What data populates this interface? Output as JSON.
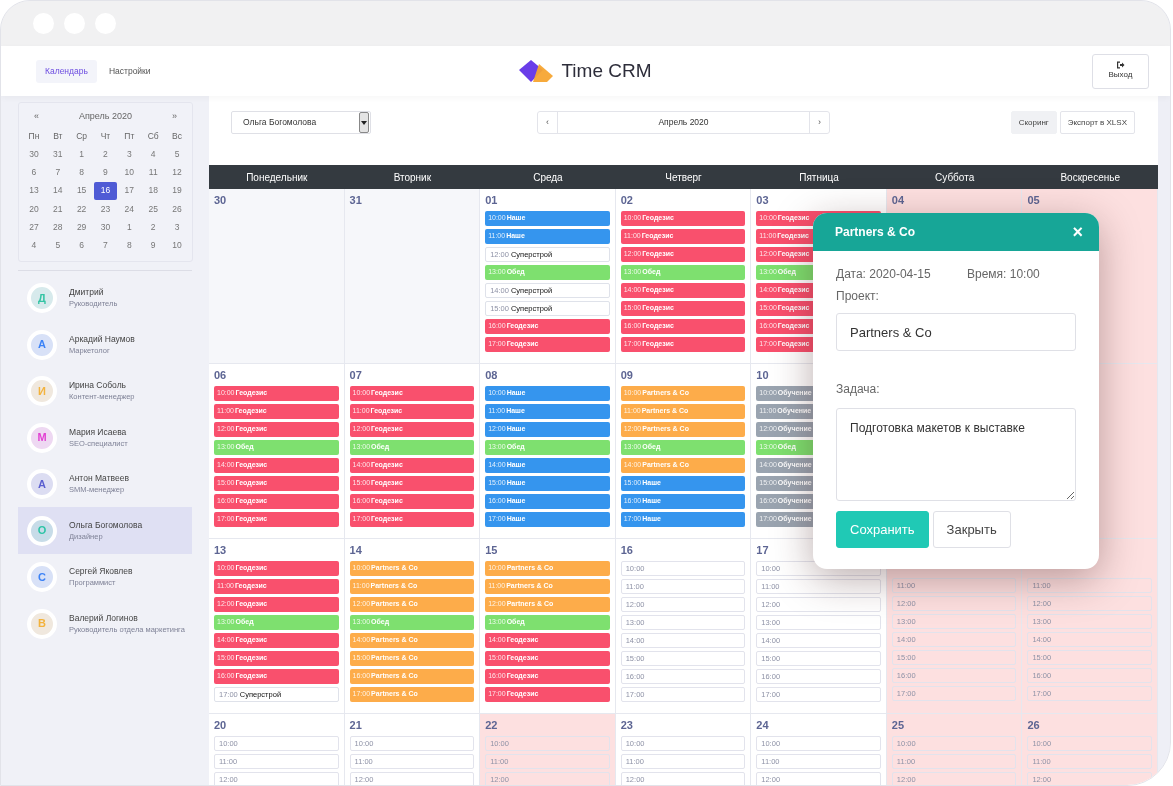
{
  "header": {
    "tabs": [
      {
        "label": "Календарь",
        "selected": true
      },
      {
        "label": "Настройки",
        "selected": false
      }
    ],
    "logo": "Time CRM",
    "logout": "Выход"
  },
  "sidebar": {
    "mini_calendar": {
      "prev": "«",
      "title": "Апрель 2020",
      "next": "»",
      "weekdays": [
        "Пн",
        "Вт",
        "Ср",
        "Чт",
        "Пт",
        "Сб",
        "Вс"
      ],
      "dates": [
        {
          "label": "30",
          "selected": false
        },
        {
          "label": "31",
          "selected": false
        },
        {
          "label": "1",
          "selected": false
        },
        {
          "label": "2",
          "selected": false
        },
        {
          "label": "3",
          "selected": false
        },
        {
          "label": "4",
          "selected": false
        },
        {
          "label": "5",
          "selected": false
        },
        {
          "label": "6",
          "selected": false
        },
        {
          "label": "7",
          "selected": false
        },
        {
          "label": "8",
          "selected": false
        },
        {
          "label": "9",
          "selected": false
        },
        {
          "label": "10",
          "selected": false
        },
        {
          "label": "11",
          "selected": false
        },
        {
          "label": "12",
          "selected": false
        },
        {
          "label": "13",
          "selected": false
        },
        {
          "label": "14",
          "selected": false
        },
        {
          "label": "15",
          "selected": false
        },
        {
          "label": "16",
          "selected": true
        },
        {
          "label": "17",
          "selected": false
        },
        {
          "label": "18",
          "selected": false
        },
        {
          "label": "19",
          "selected": false
        },
        {
          "label": "20",
          "selected": false
        },
        {
          "label": "21",
          "selected": false
        },
        {
          "label": "22",
          "selected": false
        },
        {
          "label": "23",
          "selected": false
        },
        {
          "label": "24",
          "selected": false
        },
        {
          "label": "25",
          "selected": false
        },
        {
          "label": "26",
          "selected": false
        },
        {
          "label": "27",
          "selected": false
        },
        {
          "label": "28",
          "selected": false
        },
        {
          "label": "29",
          "selected": false
        },
        {
          "label": "30",
          "selected": false
        },
        {
          "label": "1",
          "selected": false
        },
        {
          "label": "2",
          "selected": false
        },
        {
          "label": "3",
          "selected": false
        },
        {
          "label": "4",
          "selected": false
        },
        {
          "label": "5",
          "selected": false
        },
        {
          "label": "6",
          "selected": false
        },
        {
          "label": "7",
          "selected": false
        },
        {
          "label": "8",
          "selected": false
        },
        {
          "label": "9",
          "selected": false
        },
        {
          "label": "10",
          "selected": false
        }
      ]
    },
    "people": [
      {
        "initial": "Д",
        "name": "Дмитрий",
        "role": "Руководитель",
        "color": "#35c4a4",
        "selected": false
      },
      {
        "initial": "А",
        "name": "Аркадий Наумов",
        "role": "Маркетолог",
        "color": "#3b82f6",
        "selected": false
      },
      {
        "initial": "И",
        "name": "Ирина Соболь",
        "role": "Контент-менеджер",
        "color": "#f3b23c",
        "selected": false
      },
      {
        "initial": "М",
        "name": "Мария Исаева",
        "role": "SEO-специалист",
        "color": "#e23fd2",
        "selected": false
      },
      {
        "initial": "А",
        "name": "Антон Матвеев",
        "role": "SMM-менеджер",
        "color": "#5b5fd0",
        "selected": false
      },
      {
        "initial": "О",
        "name": "Ольга Богомолова",
        "role": "Дизайнер",
        "color": "#2cc4a6",
        "selected": true
      },
      {
        "initial": "С",
        "name": "Сергей Яковлев",
        "role": "Программист",
        "color": "#3b82f6",
        "selected": false
      },
      {
        "initial": "В",
        "name": "Валерий Логинов",
        "role": "Руководитель отдела маркетинга",
        "color": "#f3b23c",
        "selected": false
      }
    ]
  },
  "toolbar": {
    "employee_select": "Ольга Богомолова",
    "prev": "‹",
    "month": "Апрель 2020",
    "next": "›",
    "buttons": [
      {
        "label": "Скоринг",
        "kind": "filled"
      },
      {
        "label": "Экспорт в XLSX",
        "kind": "outline"
      }
    ]
  },
  "calendar": {
    "weekdays": [
      "Понедельник",
      "Вторник",
      "Среда",
      "Четверг",
      "Пятница",
      "Суббота",
      "Воскресенье"
    ],
    "weeks": [
      [
        {
          "day": "30",
          "kind": "outside"
        },
        {
          "day": "31",
          "kind": "outside"
        },
        {
          "day": "01",
          "kind": "workday",
          "slots": [
            {
              "time": "10:00",
              "title": "Наше",
              "color": "#3595ee"
            },
            {
              "time": "11:00",
              "title": "Наше",
              "color": "#3595ee"
            },
            {
              "time": "12:00",
              "title": "Суперстрой"
            },
            {
              "time": "13:00",
              "title": "Обед",
              "color": "#7ee06f"
            },
            {
              "time": "14:00",
              "title": "Суперстрой"
            },
            {
              "time": "15:00",
              "title": "Суперстрой"
            },
            {
              "time": "16:00",
              "title": "Геодезис",
              "color": "#f9506d"
            },
            {
              "time": "17:00",
              "title": "Геодезис",
              "color": "#f9506d"
            }
          ]
        },
        {
          "day": "02",
          "kind": "workday",
          "slots": [
            {
              "time": "10:00",
              "title": "Геодезис",
              "color": "#f9506d"
            },
            {
              "time": "11:00",
              "title": "Геодезис",
              "color": "#f9506d"
            },
            {
              "time": "12:00",
              "title": "Геодезис",
              "color": "#f9506d"
            },
            {
              "time": "13:00",
              "title": "Обед",
              "color": "#7ee06f"
            },
            {
              "time": "14:00",
              "title": "Геодезис",
              "color": "#f9506d"
            },
            {
              "time": "15:00",
              "title": "Геодезис",
              "color": "#f9506d"
            },
            {
              "time": "16:00",
              "title": "Геодезис",
              "color": "#f9506d"
            },
            {
              "time": "17:00",
              "title": "Геодезис",
              "color": "#f9506d"
            }
          ]
        },
        {
          "day": "03",
          "kind": "workday",
          "slots": [
            {
              "time": "10:00",
              "title": "Геодезис",
              "color": "#f9506d"
            },
            {
              "time": "11:00",
              "title": "Геодезис",
              "color": "#f9506d"
            },
            {
              "time": "12:00",
              "title": "Геодезис",
              "color": "#f9506d"
            },
            {
              "time": "13:00",
              "title": "Обед",
              "color": "#7ee06f"
            },
            {
              "time": "14:00",
              "title": "Геодезис",
              "color": "#f9506d"
            },
            {
              "time": "15:00",
              "title": "Геодезис",
              "color": "#f9506d"
            },
            {
              "time": "16:00",
              "title": "Геодезис",
              "color": "#f9506d"
            },
            {
              "time": "17:00",
              "title": "Геодезис",
              "color": "#f9506d"
            }
          ]
        },
        {
          "day": "04",
          "kind": "dayoff"
        },
        {
          "day": "05",
          "kind": "dayoff"
        }
      ],
      [
        {
          "day": "06",
          "kind": "workday",
          "slots": [
            {
              "time": "10:00",
              "title": "Геодезис",
              "color": "#f9506d"
            },
            {
              "time": "11:00",
              "title": "Геодезис",
              "color": "#f9506d"
            },
            {
              "time": "12:00",
              "title": "Геодезис",
              "color": "#f9506d"
            },
            {
              "time": "13:00",
              "title": "Обед",
              "color": "#7ee06f"
            },
            {
              "time": "14:00",
              "title": "Геодезис",
              "color": "#f9506d"
            },
            {
              "time": "15:00",
              "title": "Геодезис",
              "color": "#f9506d"
            },
            {
              "time": "16:00",
              "title": "Геодезис",
              "color": "#f9506d"
            },
            {
              "time": "17:00",
              "title": "Геодезис",
              "color": "#f9506d"
            }
          ]
        },
        {
          "day": "07",
          "kind": "workday",
          "slots": [
            {
              "time": "10:00",
              "title": "Геодезис",
              "color": "#f9506d"
            },
            {
              "time": "11:00",
              "title": "Геодезис",
              "color": "#f9506d"
            },
            {
              "time": "12:00",
              "title": "Геодезис",
              "color": "#f9506d"
            },
            {
              "time": "13:00",
              "title": "Обед",
              "color": "#7ee06f"
            },
            {
              "time": "14:00",
              "title": "Геодезис",
              "color": "#f9506d"
            },
            {
              "time": "15:00",
              "title": "Геодезис",
              "color": "#f9506d"
            },
            {
              "time": "16:00",
              "title": "Геодезис",
              "color": "#f9506d"
            },
            {
              "time": "17:00",
              "title": "Геодезис",
              "color": "#f9506d"
            }
          ]
        },
        {
          "day": "08",
          "kind": "workday",
          "slots": [
            {
              "time": "10:00",
              "title": "Наше",
              "color": "#3595ee"
            },
            {
              "time": "11:00",
              "title": "Наше",
              "color": "#3595ee"
            },
            {
              "time": "12:00",
              "title": "Наше",
              "color": "#3595ee"
            },
            {
              "time": "13:00",
              "title": "Обед",
              "color": "#7ee06f"
            },
            {
              "time": "14:00",
              "title": "Наше",
              "color": "#3595ee"
            },
            {
              "time": "15:00",
              "title": "Наше",
              "color": "#3595ee"
            },
            {
              "time": "16:00",
              "title": "Наше",
              "color": "#3595ee"
            },
            {
              "time": "17:00",
              "title": "Наше",
              "color": "#3595ee"
            }
          ]
        },
        {
          "day": "09",
          "kind": "workday",
          "slots": [
            {
              "time": "10:00",
              "title": "Partners & Co",
              "color": "#fdac4a"
            },
            {
              "time": "11:00",
              "title": "Partners & Co",
              "color": "#fdac4a"
            },
            {
              "time": "12:00",
              "title": "Partners & Co",
              "color": "#fdac4a"
            },
            {
              "time": "13:00",
              "title": "Обед",
              "color": "#7ee06f"
            },
            {
              "time": "14:00",
              "title": "Partners & Co",
              "color": "#fdac4a"
            },
            {
              "time": "15:00",
              "title": "Наше",
              "color": "#3595ee"
            },
            {
              "time": "16:00",
              "title": "Наше",
              "color": "#3595ee"
            },
            {
              "time": "17:00",
              "title": "Наше",
              "color": "#3595ee"
            }
          ]
        },
        {
          "day": "10",
          "kind": "workday",
          "slots": [
            {
              "time": "10:00",
              "title": "Обучение",
              "color": "#9aa4b0"
            },
            {
              "time": "11:00",
              "title": "Обучение",
              "color": "#9aa4b0"
            },
            {
              "time": "12:00",
              "title": "Обучение",
              "color": "#9aa4b0"
            },
            {
              "time": "13:00",
              "title": "Обед",
              "color": "#7ee06f"
            },
            {
              "time": "14:00",
              "title": "Обучение",
              "color": "#9aa4b0"
            },
            {
              "time": "15:00",
              "title": "Обучение",
              "color": "#9aa4b0"
            },
            {
              "time": "16:00",
              "title": "Обучение",
              "color": "#9aa4b0"
            },
            {
              "time": "17:00",
              "title": "Обучение",
              "color": "#9aa4b0"
            }
          ]
        },
        {
          "kind": "dayoff"
        }
      ],
      [
        {
          "day": "13",
          "kind": "workday",
          "slots": [
            {
              "time": "10:00",
              "title": "Геодезис",
              "color": "#f9506d"
            },
            {
              "time": "11:00",
              "title": "Геодезис",
              "color": "#f9506d"
            },
            {
              "time": "12:00",
              "title": "Геодезис",
              "color": "#f9506d"
            },
            {
              "time": "13:00",
              "title": "Обед",
              "color": "#7ee06f"
            },
            {
              "time": "14:00",
              "title": "Геодезис",
              "color": "#f9506d"
            },
            {
              "time": "15:00",
              "title": "Геодезис",
              "color": "#f9506d"
            },
            {
              "time": "16:00",
              "title": "Геодезис",
              "color": "#f9506d"
            },
            {
              "time": "17:00",
              "title": "Суперстрой"
            }
          ]
        },
        {
          "day": "14",
          "kind": "workday",
          "slots": [
            {
              "time": "10:00",
              "title": "Partners & Co",
              "color": "#fdac4a"
            },
            {
              "time": "11:00",
              "title": "Partners & Co",
              "color": "#fdac4a"
            },
            {
              "time": "12:00",
              "title": "Partners & Co",
              "color": "#fdac4a"
            },
            {
              "time": "13:00",
              "title": "Обед",
              "color": "#7ee06f"
            },
            {
              "time": "14:00",
              "title": "Partners & Co",
              "color": "#fdac4a"
            },
            {
              "time": "15:00",
              "title": "Partners & Co",
              "color": "#fdac4a"
            },
            {
              "time": "16:00",
              "title": "Partners & Co",
              "color": "#fdac4a"
            },
            {
              "time": "17:00",
              "title": "Partners & Co",
              "color": "#fdac4a"
            }
          ]
        },
        {
          "day": "15",
          "kind": "workday",
          "slots": [
            {
              "time": "10:00",
              "title": "Partners & Co",
              "color": "#fdac4a"
            },
            {
              "time": "11:00",
              "title": "Partners & Co",
              "color": "#fdac4a"
            },
            {
              "time": "12:00",
              "title": "Partners & Co",
              "color": "#fdac4a"
            },
            {
              "time": "13:00",
              "title": "Обед",
              "color": "#7ee06f"
            },
            {
              "time": "14:00",
              "title": "Геодезис",
              "color": "#f9506d"
            },
            {
              "time": "15:00",
              "title": "Геодезис",
              "color": "#f9506d"
            },
            {
              "time": "16:00",
              "title": "Геодезис",
              "color": "#f9506d"
            },
            {
              "time": "17:00",
              "title": "Геодезис",
              "color": "#f9506d"
            }
          ]
        },
        {
          "day": "16",
          "kind": "workday",
          "slots": [
            {
              "time": "10:00"
            },
            {
              "time": "11:00"
            },
            {
              "time": "12:00"
            },
            {
              "time": "13:00"
            },
            {
              "time": "14:00"
            },
            {
              "time": "15:00"
            },
            {
              "time": "16:00"
            },
            {
              "time": "17:00"
            }
          ]
        },
        {
          "day": "17",
          "kind": "workday",
          "slots": [
            {
              "time": "10:00"
            },
            {
              "time": "11:00"
            },
            {
              "time": "12:00"
            },
            {
              "time": "13:00"
            },
            {
              "time": "14:00"
            },
            {
              "time": "15:00"
            },
            {
              "time": "16:00"
            },
            {
              "time": "17:00"
            }
          ]
        },
        {
          "kind": "dayoff",
          "slots": [
            {
              "time": "11:00"
            },
            {
              "time": "12:00"
            },
            {
              "time": "13:00"
            },
            {
              "time": "14:00"
            },
            {
              "time": "15:00"
            },
            {
              "time": "16:00"
            },
            {
              "time": "17:00"
            }
          ]
        },
        {
          "kind": "dayoff",
          "slots": [
            {
              "time": "11:00"
            },
            {
              "time": "12:00"
            },
            {
              "time": "13:00"
            },
            {
              "time": "14:00"
            },
            {
              "time": "15:00"
            },
            {
              "time": "16:00"
            },
            {
              "time": "17:00"
            }
          ]
        }
      ],
      [
        {
          "day": "20",
          "kind": "workday",
          "slots": [
            {
              "time": "10:00"
            },
            {
              "time": "11:00"
            },
            {
              "time": "12:00"
            }
          ]
        },
        {
          "day": "21",
          "kind": "workday",
          "slots": [
            {
              "time": "10:00"
            },
            {
              "time": "11:00"
            },
            {
              "time": "12:00"
            }
          ]
        },
        {
          "day": "22",
          "kind": "dayoff",
          "slots": [
            {
              "time": "10:00"
            },
            {
              "time": "11:00"
            },
            {
              "time": "12:00"
            }
          ]
        },
        {
          "day": "23",
          "kind": "workday",
          "slots": [
            {
              "time": "10:00"
            },
            {
              "time": "11:00"
            },
            {
              "time": "12:00"
            }
          ]
        },
        {
          "day": "24",
          "kind": "workday",
          "slots": [
            {
              "time": "10:00"
            },
            {
              "time": "11:00"
            },
            {
              "time": "12:00"
            }
          ]
        },
        {
          "day": "25",
          "kind": "dayoff",
          "slots": [
            {
              "time": "10:00"
            },
            {
              "time": "11:00"
            },
            {
              "time": "12:00"
            }
          ]
        },
        {
          "day": "26",
          "kind": "dayoff",
          "slots": [
            {
              "time": "10:00"
            },
            {
              "time": "11:00"
            },
            {
              "time": "12:00"
            }
          ]
        }
      ]
    ]
  },
  "popup": {
    "title": "Partners & Co",
    "close": "×",
    "date": "Дата: 2020-04-15",
    "time": "Время: 10:00",
    "project_label": "Проект:",
    "project_value": "Partners & Co",
    "task_label": "Задача:",
    "task_value": "Подготовка макетов к выставке",
    "buttons": [
      {
        "label": "Сохранить",
        "kind": "primary"
      },
      {
        "label": "Закрыть",
        "kind": "secondary"
      }
    ]
  }
}
